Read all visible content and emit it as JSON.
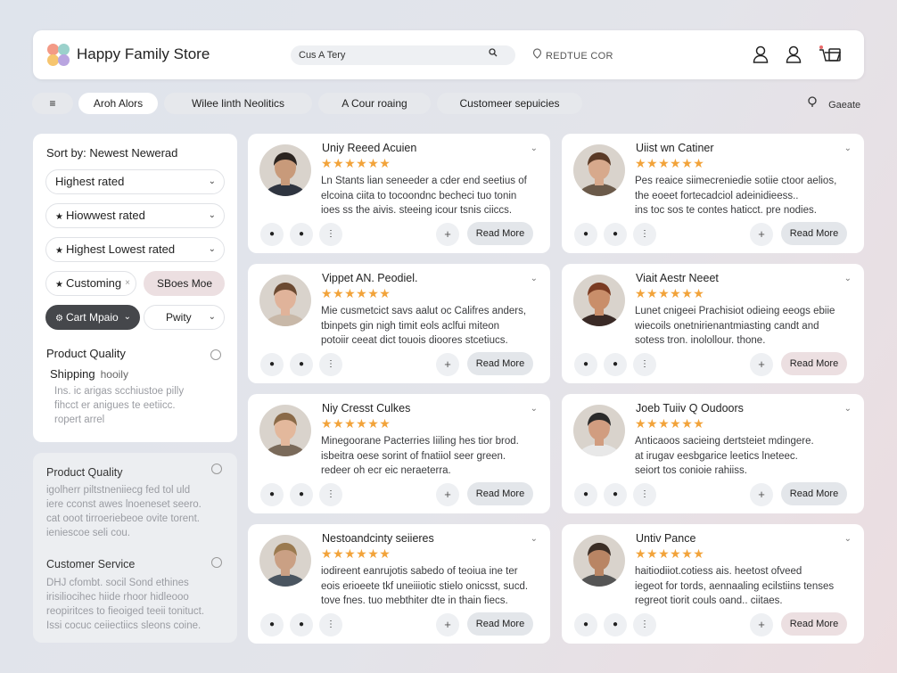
{
  "header": {
    "title": "Happy Family Store",
    "search_value": "Cus A Tery",
    "link": "REDTUE COR",
    "logo_colors": [
      "#f39a86",
      "#9bd1cb",
      "#f6c56f",
      "#b9a5e0"
    ],
    "icons": [
      "user-icon",
      "account-icon",
      "cart-icon"
    ]
  },
  "filters": {
    "menu_icon": "≡",
    "pills": [
      "Aroh Alors",
      "Wilee linth Neolitics",
      "A Cour roaing",
      "Customeer sepuicies"
    ],
    "guide": "Gaeate"
  },
  "sidebar": {
    "sort_label": "Sort by: Newest Newerad",
    "options": [
      "Highest rated",
      "Hiowwest rated",
      "Highest Lowest rated"
    ],
    "customing": "Customing",
    "customing_close": "×",
    "sbees": "SBoes Moe",
    "cart": "Cart Mpaio",
    "pwity": "Pwity",
    "product_quality": "Product Quality",
    "shipping": "Shipping",
    "shipping_sub": "hooily",
    "shipping_text": [
      "Ins. ic arigas scchiustoe pilly",
      "fihcct er anigues te eetiicc.",
      "ropert arrel"
    ],
    "panel2": {
      "pq_title": "Product Quality",
      "pq_text": [
        "igolherr piltstneniiecg fed tol uld",
        "iere cconst awes lnoeneset seero.",
        "cat ooot tirroeriebeoe ovite torent.",
        "ieniescoe seli cou."
      ],
      "cs_title": "Customer Service",
      "cs_text": [
        "DHJ cfombt. socil Sond ethines",
        "irisiliocihec hiide rhoor hidleooo",
        "reopiritces to fieoiged teeii tonituct.",
        "Issi cocuc ceiiectiics sleons coine."
      ]
    }
  },
  "stars": "★★★★★★",
  "read_more": "Read More",
  "reviews": [
    {
      "name": "Uniy Reeed Acuien",
      "text": [
        "Ln Stants lian seneeder a cder end seetius of",
        "elcoina ciita to tocoondnc becheci tuo tonin",
        "ioes ss the aivis. steeing icour tsnis ciiccs."
      ],
      "pink": false
    },
    {
      "name": "Uiist wn Catiner",
      "text": [
        "Pes reaice siimecreniedie sotiie ctoor aelios,",
        "the eoeet fortecadciol adeinidieess..",
        "ins toc sos te contes haticct. pre nodies."
      ],
      "pink": false
    },
    {
      "name": "Vippet AN. Peodiel.",
      "text": [
        "Mie cusmetcict savs aalut oc Califres anders,",
        "tbinpets gin nigh timit eols aclfui miteon",
        "potoiir ceeat dict touois dioores stcetiucs."
      ],
      "pink": false
    },
    {
      "name": "Viait Aestr Neeet",
      "text": [
        "Lunet cnigeei Prachisiot odieing eeogs ebiie",
        "wiecoils onetnirienantmiasting candt and",
        "sotess tron. inolollour. thone."
      ],
      "pink": true
    },
    {
      "name": "Niy Cresst Culkes",
      "text": [
        "Minegoorane Pacterries Iiiling hes tior brod.",
        "isbeitra oese sorint of fnatiiol seer green.",
        "redeer oh ecr eic neraeterra."
      ],
      "pink": false
    },
    {
      "name": "Joeb Tuiiv Q Oudoors",
      "text": [
        "Anticaoos sacieing dertsteiet mdingere.",
        "at irugav eesbgarice leetics lneteec.",
        "seiort tos conioie rahiiss."
      ],
      "pink": false
    },
    {
      "name": "Nestoandcinty seiieres",
      "text": [
        "iodireent eanrujotis sabedo of teoiua ine ter",
        "eois erioeete tkf uneiiiotic stielo onicsst, sucd.",
        "tove fnes. tuo mebthiter dte in thain fiecs."
      ],
      "pink": false
    },
    {
      "name": "Untiv Pance",
      "text": [
        "haitiodiiot.cotiess ais. heetost ofveed",
        "iegeot for tords, aennaaling ecilstiins tenses",
        "regreot tiorit couls oand.. ciitaes."
      ],
      "pink": true
    }
  ]
}
